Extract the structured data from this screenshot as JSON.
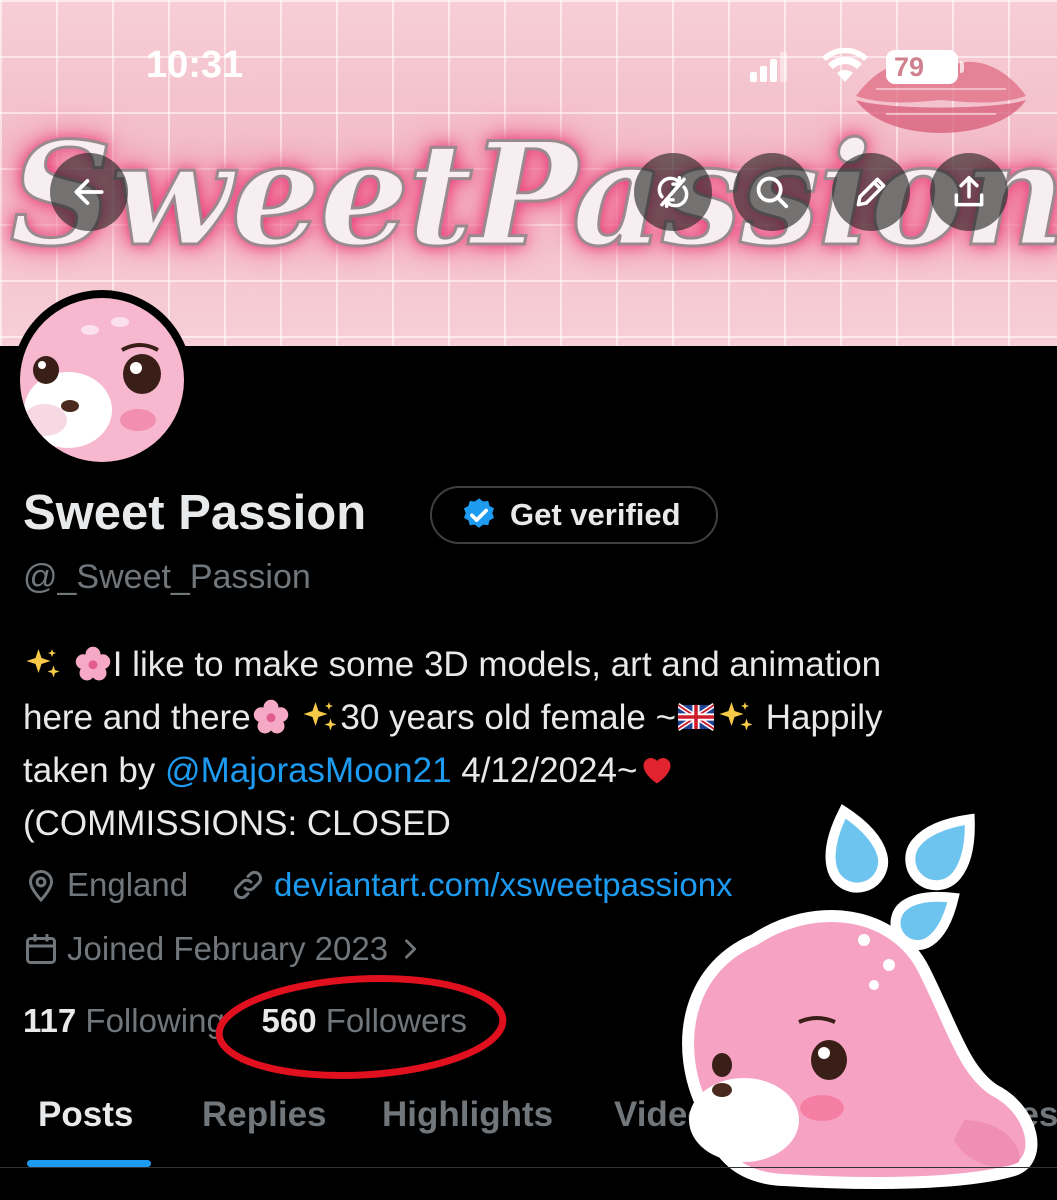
{
  "status_bar": {
    "time": "10:31",
    "battery": "79"
  },
  "banner": {
    "title": "SweetPassion"
  },
  "profile": {
    "name": "Sweet Passion",
    "verify_label": "Get verified",
    "handle": "@_Sweet_Passion",
    "bio": {
      "line1": "I like to make some 3D models, art and animation",
      "line2a": "here and there",
      "line2b": "30 years old female ~",
      "line2c": "Happily",
      "line3a": "taken by ",
      "line3_mention": "@MajorasMoon21",
      "line3b": " 4/12/2024~",
      "line4": "(COMMISSIONS: CLOSED"
    },
    "location": "England",
    "website": "deviantart.com/xsweetpassionx",
    "joined": "Joined February 2023",
    "following_count": "117",
    "following_label": "Following",
    "followers_count": "560",
    "followers_label": "Followers"
  },
  "tabs": [
    "Posts",
    "Replies",
    "Highlights",
    "Videos",
    "Articles"
  ],
  "icons": {
    "back": "arrow-left-icon",
    "translate": "no-sync-icon",
    "search": "search-icon",
    "edit": "pencil-icon",
    "share": "share-icon"
  },
  "colors": {
    "accent": "#1d9bf0",
    "annotation": "#e0101e",
    "banner": "#f4c6cf"
  }
}
